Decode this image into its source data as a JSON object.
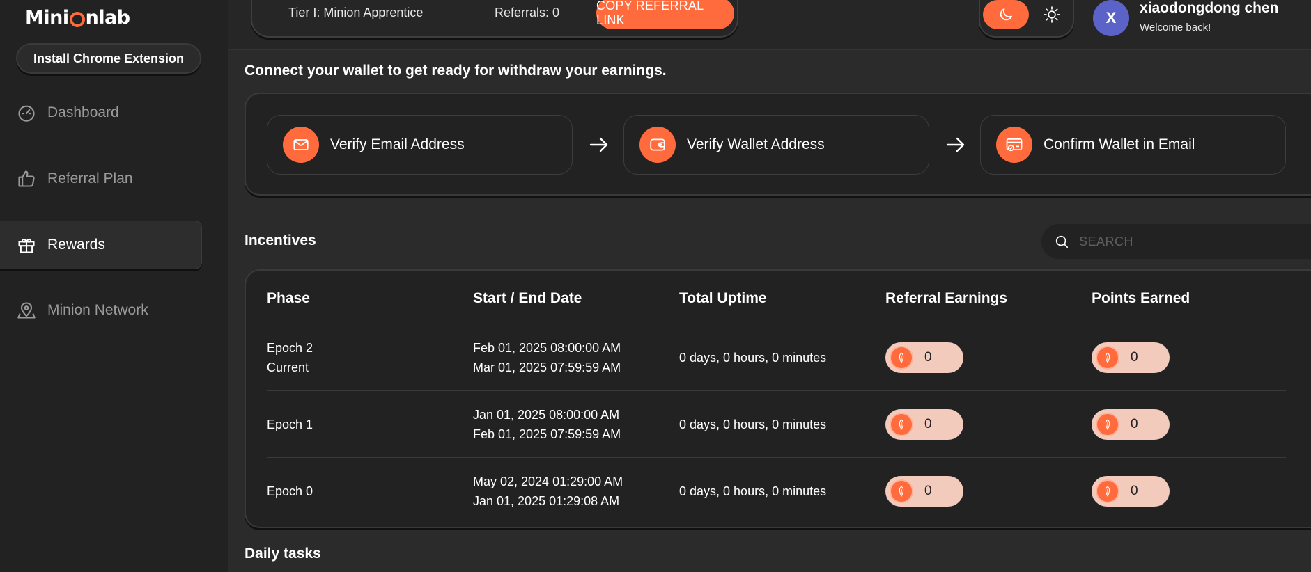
{
  "sidebar": {
    "logo": {
      "left": "Mini",
      "right": "nlab"
    },
    "install_button": "Install Chrome Extension",
    "items": [
      {
        "label": "Dashboard",
        "icon": "gauge-icon",
        "active": false
      },
      {
        "label": "Referral Plan",
        "icon": "thumbs-up-icon",
        "active": false
      },
      {
        "label": "Rewards",
        "icon": "gift-icon",
        "active": true
      },
      {
        "label": "Minion Network",
        "icon": "map-pin-icon",
        "active": false
      }
    ]
  },
  "header": {
    "tier": "Tier I: Minion Apprentice",
    "referrals": "Referrals: 0",
    "copy_button": "COPY REFERRAL LINK",
    "user": {
      "initial": "X",
      "name": "xiaodongdong chen",
      "greeting": "Welcome back!"
    }
  },
  "main": {
    "wallet_title": "Connect your wallet to get ready for withdraw your earnings.",
    "steps": [
      {
        "label": "Verify Email Address",
        "icon": "mail-icon"
      },
      {
        "label": "Verify Wallet Address",
        "icon": "wallet-icon"
      },
      {
        "label": "Confirm Wallet in Email",
        "icon": "card-check-icon"
      }
    ],
    "incentives_title": "Incentives",
    "search_placeholder": "SEARCH",
    "table": {
      "headers": [
        "Phase",
        "Start / End Date",
        "Total Uptime",
        "Referral Earnings",
        "Points Earned"
      ],
      "rows": [
        {
          "phase": "Epoch 2",
          "phase_sub": "Current",
          "start": "Feb 01, 2025 08:00:00 AM",
          "end": "Mar 01, 2025 07:59:59 AM",
          "uptime": "0 days, 0 hours, 0 minutes",
          "referral": "0",
          "points": "0"
        },
        {
          "phase": "Epoch 1",
          "phase_sub": "",
          "start": "Jan 01, 2025 08:00:00 AM",
          "end": "Feb 01, 2025 07:59:59 AM",
          "uptime": "0 days, 0 hours, 0 minutes",
          "referral": "0",
          "points": "0"
        },
        {
          "phase": "Epoch 0",
          "phase_sub": "",
          "start": "May 02, 2024 01:29:00 AM",
          "end": "Jan 01, 2025 01:29:08 AM",
          "uptime": "0 days, 0 hours, 0 minutes",
          "referral": "0",
          "points": "0"
        }
      ]
    },
    "daily_tasks_title": "Daily tasks"
  },
  "colors": {
    "accent": "#ff6b3d",
    "background": "#2b2b2b",
    "sidebar": "#222222",
    "badge": "#f3cbbd",
    "avatar": "#5b63c8"
  }
}
